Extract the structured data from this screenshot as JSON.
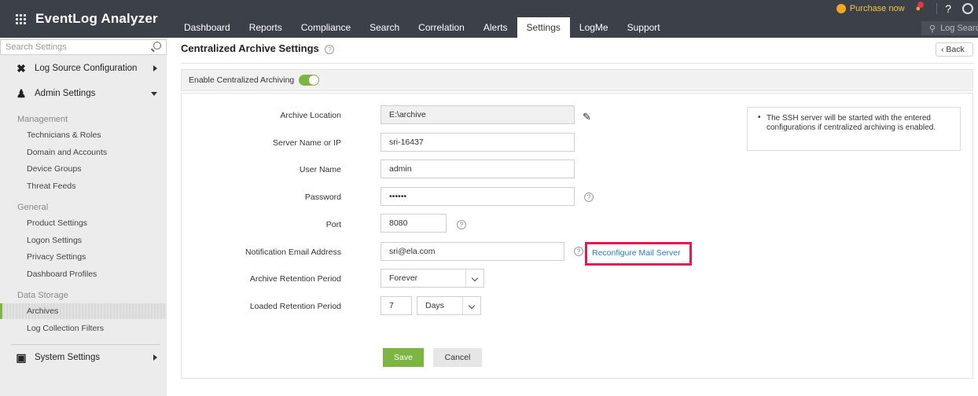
{
  "app": {
    "name": "EventLog Analyzer"
  },
  "nav": {
    "tabs": [
      {
        "label": "Dashboard"
      },
      {
        "label": "Reports"
      },
      {
        "label": "Compliance"
      },
      {
        "label": "Search"
      },
      {
        "label": "Correlation"
      },
      {
        "label": "Alerts"
      },
      {
        "label": "Settings",
        "active": true
      },
      {
        "label": "LogMe"
      },
      {
        "label": "Support"
      }
    ],
    "purchase_label": "Purchase now",
    "help_label": "?",
    "log_search_label": "Log Search"
  },
  "sidebar": {
    "search_placeholder": "Search Settings",
    "sections": {
      "log_source": "Log Source Configuration",
      "admin": "Admin Settings",
      "system": "System Settings"
    },
    "groups": {
      "management": "Management",
      "general": "General",
      "data_storage": "Data Storage"
    },
    "items": {
      "technicians": "Technicians & Roles",
      "domain": "Domain and Accounts",
      "device_groups": "Device Groups",
      "threat_feeds": "Threat Feeds",
      "product_settings": "Product Settings",
      "logon_settings": "Logon Settings",
      "privacy_settings": "Privacy Settings",
      "dashboard_profiles": "Dashboard Profiles",
      "archives": "Archives",
      "log_collection_filters": "Log Collection Filters"
    }
  },
  "page": {
    "title": "Centralized Archive Settings",
    "back_label": "Back",
    "enable_label": "Enable Centralized Archiving",
    "enabled": true
  },
  "form": {
    "archive_location": {
      "label": "Archive Location",
      "value": "E:\\archive"
    },
    "server": {
      "label": "Server Name or IP",
      "value": "sri-16437"
    },
    "user": {
      "label": "User Name",
      "value": "admin"
    },
    "password": {
      "label": "Password",
      "value": "••••••"
    },
    "port": {
      "label": "Port",
      "value": "8080"
    },
    "email": {
      "label": "Notification Email Address",
      "value": "sri@ela.com"
    },
    "reconfigure_link": "Reconfigure Mail Server",
    "archive_retention": {
      "label": "Archive Retention Period",
      "value": "Forever"
    },
    "loaded_retention": {
      "label": "Loaded Retention Period",
      "value": "7",
      "unit": "Days"
    },
    "info_text": "The SSH server will be started with the entered configurations if centralized archiving is enabled.",
    "save_label": "Save",
    "cancel_label": "Cancel"
  },
  "colors": {
    "topbar": "#3b4049",
    "accent_green": "#7cb542",
    "highlight_red": "#e8174f",
    "link_blue": "#2a7dbd"
  }
}
